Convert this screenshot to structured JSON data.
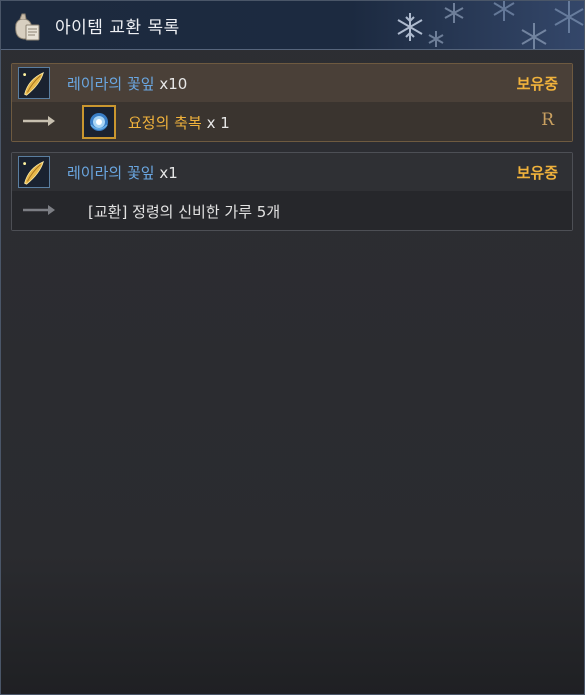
{
  "window": {
    "title": "아이템 교환 목록",
    "title_icon": "bag-scroll-icon"
  },
  "entries": [
    {
      "item_name": "레이라의 꽃잎",
      "quantity": "x10",
      "status": "보유중",
      "item_icon": "petal-icon",
      "reward_name": "요정의 축복",
      "reward_quantity": "x 1",
      "reward_icon": "fairy-blessing-icon",
      "grade": "R",
      "selected": true
    },
    {
      "item_name": "레이라의 꽃잎",
      "quantity": "x1",
      "status": "보유중",
      "item_icon": "petal-icon",
      "exchange_text": "[교환] 정령의 신비한 가루 5개",
      "selected": false
    }
  ],
  "colors": {
    "item_name": "#6aa6e0",
    "status": "#f0b23c",
    "reward_name": "#f0b23c"
  }
}
